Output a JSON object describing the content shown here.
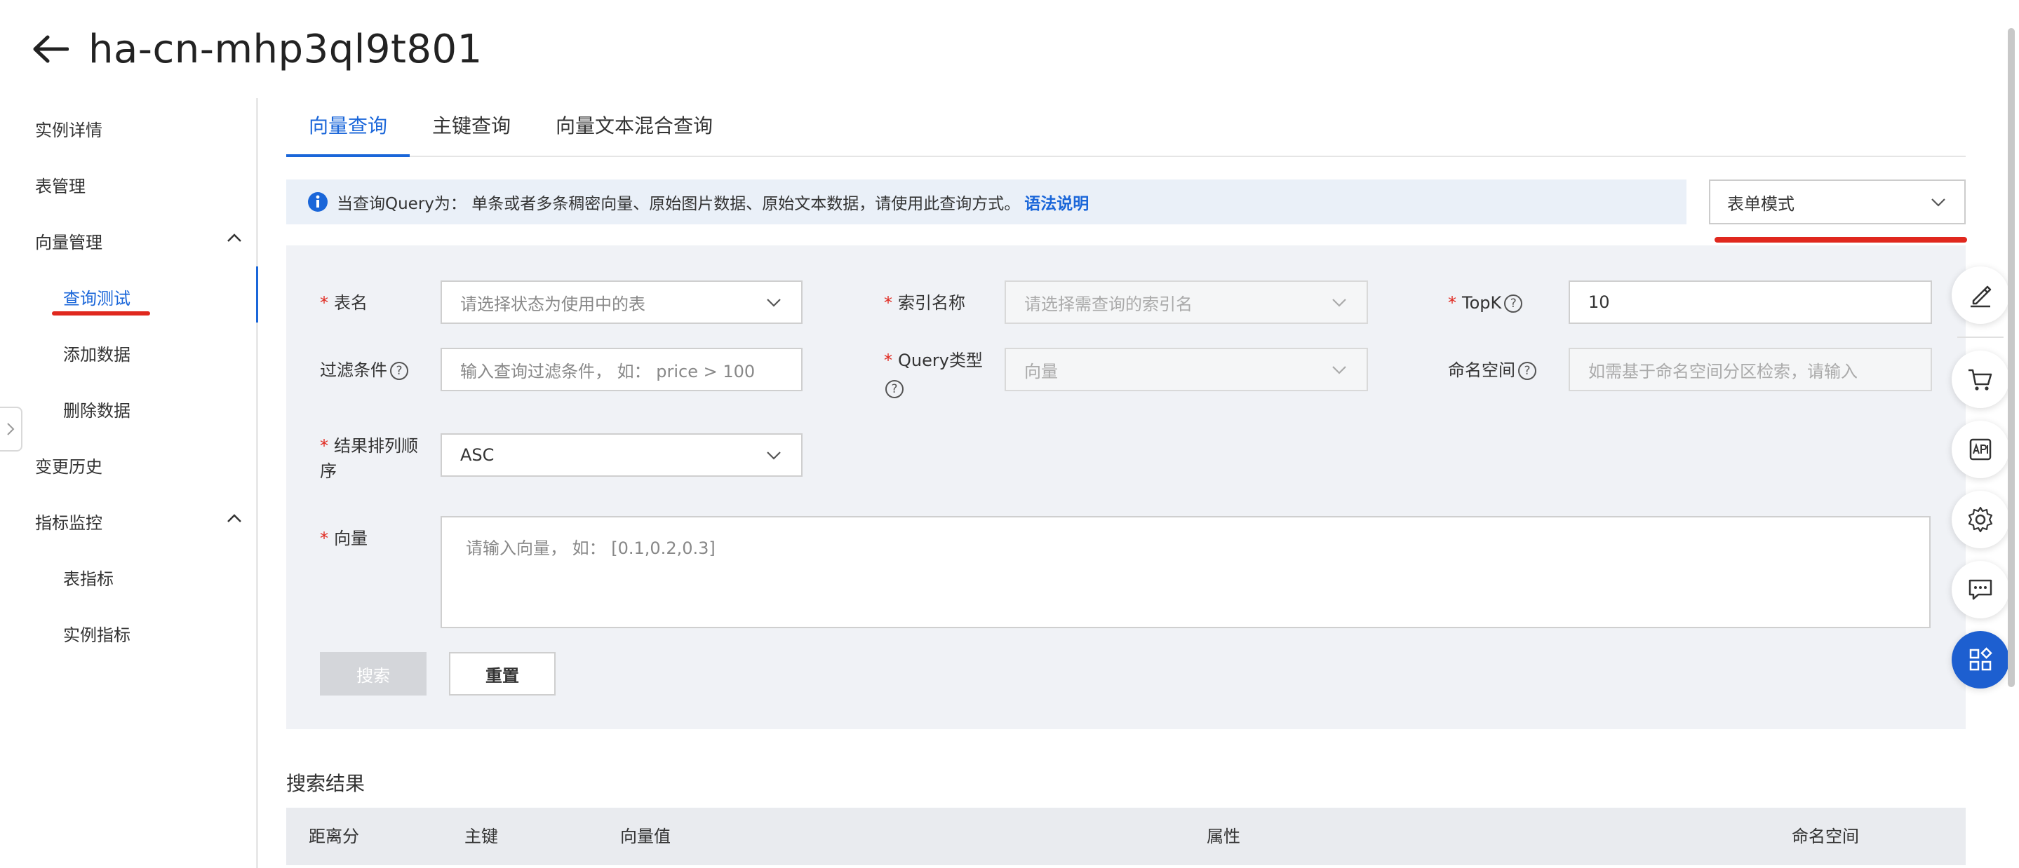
{
  "header": {
    "title": "ha-cn-mhp3ql9t801"
  },
  "sidebar": {
    "items": [
      {
        "label": "实例详情"
      },
      {
        "label": "表管理"
      },
      {
        "label": "向量管理"
      },
      {
        "label": "查询测试"
      },
      {
        "label": "添加数据"
      },
      {
        "label": "删除数据"
      },
      {
        "label": "变更历史"
      },
      {
        "label": "指标监控"
      },
      {
        "label": "表指标"
      },
      {
        "label": "实例指标"
      }
    ]
  },
  "tabs": [
    {
      "label": "向量查询"
    },
    {
      "label": "主键查询"
    },
    {
      "label": "向量文本混合查询"
    }
  ],
  "notice": {
    "text": "当查询Query为： 单条或者多条稠密向量、原始图片数据、原始文本数据，请使用此查询方式。",
    "link": "语法说明"
  },
  "mode_select": {
    "value": "表单模式"
  },
  "form": {
    "table_label": "表名",
    "table_placeholder": "请选择状态为使用中的表",
    "index_label": "索引名称",
    "index_placeholder": "请选择需查询的索引名",
    "topk_label": "TopK",
    "topk_value": "10",
    "filter_label": "过滤条件",
    "filter_placeholder": "输入查询过滤条件， 如： price > 100",
    "query_type_label": "Query类型",
    "query_type_value": "向量",
    "namespace_label": "命名空间",
    "namespace_placeholder": "如需基于命名空间分区检索，请输入",
    "order_label_1": "结果排列顺",
    "order_label_2": "序",
    "order_value": "ASC",
    "vector_label": "向量",
    "vector_placeholder": "请输入向量， 如： [0.1,0.2,0.3]",
    "help_glyph": "?"
  },
  "buttons": {
    "search": "搜索",
    "reset": "重置"
  },
  "results": {
    "title": "搜索结果",
    "columns": [
      "距离分",
      "主键",
      "向量值",
      "属性",
      "命名空间"
    ]
  },
  "tools": [
    "edit-icon",
    "cart-icon",
    "api-icon",
    "settings-icon",
    "chat-icon",
    "apps-icon"
  ],
  "colors": {
    "accent": "#1a66d9",
    "annotation_red": "#e0281e",
    "panel_bg": "#f0f2f6"
  }
}
